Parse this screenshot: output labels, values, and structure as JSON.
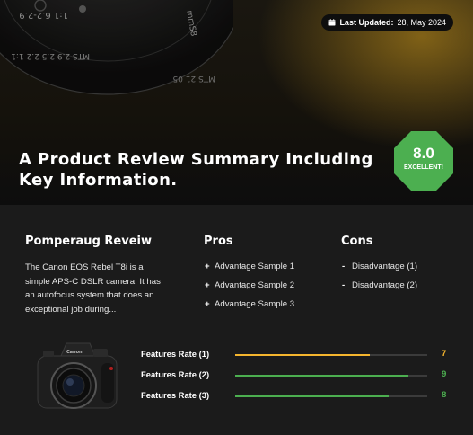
{
  "header": {
    "updated_label": "Last Updated:",
    "updated_date": "28, May 2024",
    "title": "A Product Review Summary Including Key Information."
  },
  "score": {
    "value": "8.0",
    "label": "EXCELLENT!",
    "color": "#4caf50"
  },
  "summary": {
    "title": "Pomperaug Reveiw",
    "text": "The Canon EOS Rebel T8i is a simple APS-C DSLR camera. It has an autofocus system that does an exceptional job during..."
  },
  "pros": {
    "title": "Pros",
    "items": [
      "Advantage Sample 1",
      "Advantage Sample 2",
      "Advantage Sample 3"
    ]
  },
  "cons": {
    "title": "Cons",
    "items": [
      "Disadvantage (1)",
      "Disadvantage (2)"
    ]
  },
  "features": [
    {
      "label": "Features Rate (1)",
      "value": "7",
      "fraction": 0.7,
      "color": "#f5b52e"
    },
    {
      "label": "Features Rate (2)",
      "value": "9",
      "fraction": 0.9,
      "color": "#4caf50"
    },
    {
      "label": "Features Rate (3)",
      "value": "8",
      "fraction": 0.8,
      "color": "#4caf50"
    }
  ],
  "icons": {
    "calendar": "calendar-icon",
    "camera": "camera-product-image"
  }
}
